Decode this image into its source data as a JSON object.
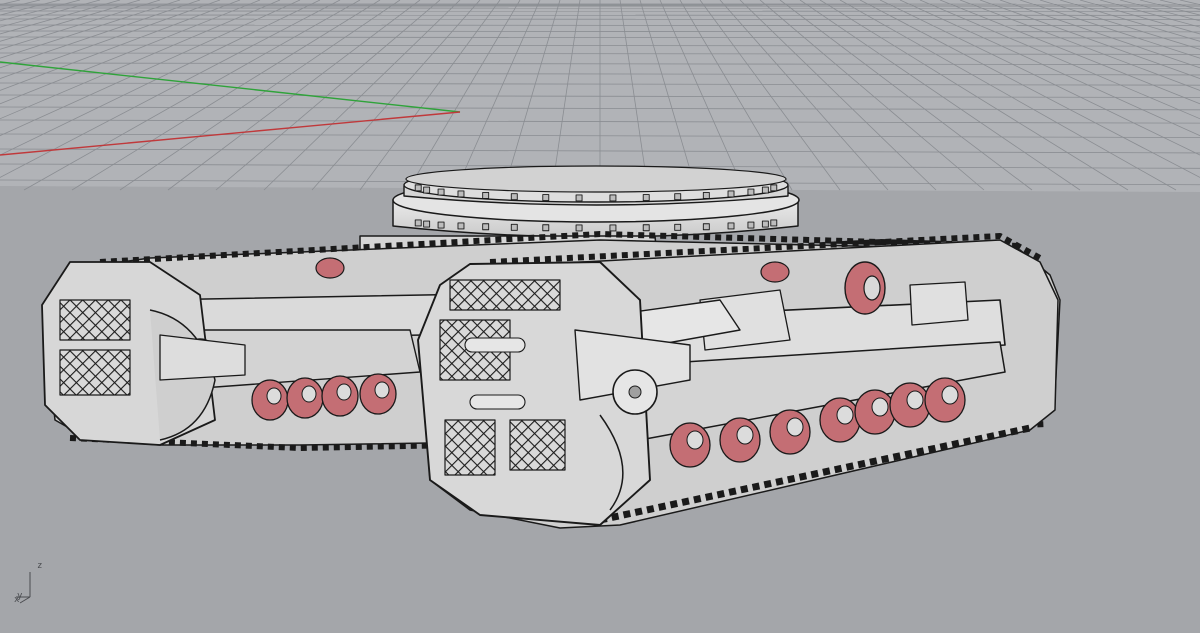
{
  "viewport": {
    "background_color": "#a4a6aa",
    "grid_color": "#8a8d92",
    "model_fill": "#dcdcdc",
    "model_stroke": "#1a1a1a",
    "roller_color": "#c46e74",
    "x_axis_color": "#c0393b",
    "y_axis_color": "#2fa33a"
  },
  "axis_widget": {
    "z_label": "z",
    "x_label": "x",
    "y_label": "y"
  },
  "model": {
    "name_icon": "tracked-undercarriage-model"
  }
}
